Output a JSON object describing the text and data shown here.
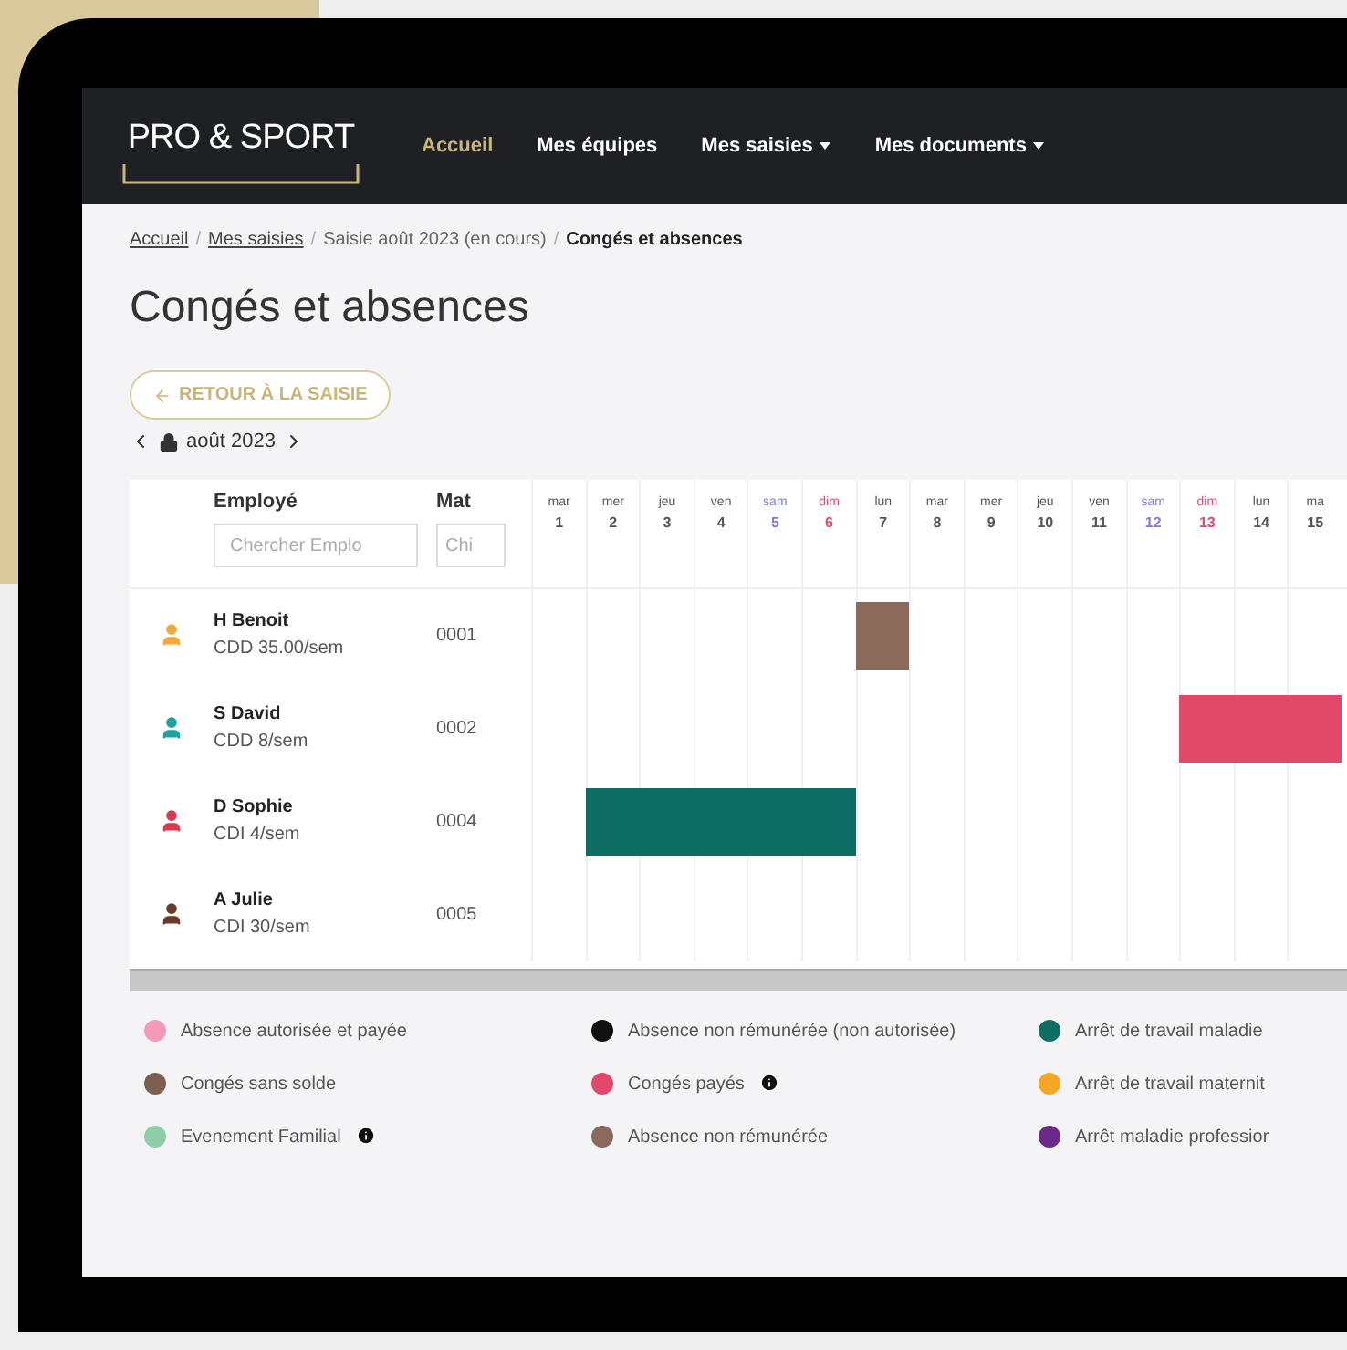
{
  "nav": {
    "logo": "PRO & SPORT",
    "links": [
      {
        "label": "Accueil",
        "selected": true,
        "dropdown": false
      },
      {
        "label": "Mes équipes",
        "selected": false,
        "dropdown": false
      },
      {
        "label": "Mes saisies",
        "selected": false,
        "dropdown": true
      },
      {
        "label": "Mes documents",
        "selected": false,
        "dropdown": true
      }
    ]
  },
  "breadcrumb": {
    "separator": "/",
    "items": [
      {
        "label": "Accueil",
        "kind": "link"
      },
      {
        "label": "Mes saisies",
        "kind": "link"
      },
      {
        "label": "Saisie août 2023 (en cours)",
        "kind": "plain"
      },
      {
        "label": "Congés et absences",
        "kind": "current"
      }
    ]
  },
  "title": "Congés et absences",
  "back_button": "RETOUR À LA SAISIE",
  "month": "août 2023",
  "table": {
    "columns": [
      "Employé",
      "Mat"
    ],
    "filters": [
      {
        "placeholder": "Chercher Emplo"
      },
      {
        "placeholder": "Chi"
      }
    ],
    "days": [
      {
        "weekday": "mar",
        "day": "1",
        "kind": "weekday"
      },
      {
        "weekday": "mer",
        "day": "2",
        "kind": "weekday"
      },
      {
        "weekday": "jeu",
        "day": "3",
        "kind": "weekday"
      },
      {
        "weekday": "ven",
        "day": "4",
        "kind": "weekday"
      },
      {
        "weekday": "sam",
        "day": "5",
        "kind": "saturday"
      },
      {
        "weekday": "dim",
        "day": "6",
        "kind": "sunday"
      },
      {
        "weekday": "lun",
        "day": "7",
        "kind": "weekday"
      },
      {
        "weekday": "mar",
        "day": "8",
        "kind": "weekday"
      },
      {
        "weekday": "mer",
        "day": "9",
        "kind": "weekday"
      },
      {
        "weekday": "jeu",
        "day": "10",
        "kind": "weekday"
      },
      {
        "weekday": "ven",
        "day": "11",
        "kind": "weekday"
      },
      {
        "weekday": "sam",
        "day": "12",
        "kind": "saturday"
      },
      {
        "weekday": "dim",
        "day": "13",
        "kind": "sunday"
      },
      {
        "weekday": "lun",
        "day": "14",
        "kind": "weekday"
      },
      {
        "weekday": "ma",
        "day": "15",
        "kind": "weekday"
      }
    ],
    "rows": [
      {
        "name": "H Benoit",
        "contract": "CDD 35.00/sem",
        "mat": "0001",
        "color": "#f2a93b",
        "cells": [
          {
            "absent": false
          },
          {
            "absent": false
          },
          {
            "absent": false
          },
          {
            "absent": false
          },
          {
            "absent": false
          },
          {
            "absent": false
          },
          {
            "absent": true,
            "color": "#8b6a5c"
          },
          {
            "absent": false
          },
          {
            "absent": false
          },
          {
            "absent": false
          },
          {
            "absent": false
          },
          {
            "absent": false
          },
          {
            "absent": false
          },
          {
            "absent": false
          },
          {
            "absent": false
          }
        ]
      },
      {
        "name": "S David",
        "contract": "CDD 8/sem",
        "mat": "0002",
        "color": "#1fa3a0",
        "cells": [
          {
            "absent": false
          },
          {
            "absent": false
          },
          {
            "absent": false
          },
          {
            "absent": false
          },
          {
            "absent": false
          },
          {
            "absent": false
          },
          {
            "absent": false
          },
          {
            "absent": false
          },
          {
            "absent": false
          },
          {
            "absent": false
          },
          {
            "absent": false
          },
          {
            "absent": false
          },
          {
            "absent": true,
            "color": "#e0496a"
          },
          {
            "absent": true,
            "color": "#e0496a"
          },
          {
            "absent": true,
            "color": "#e0496a"
          }
        ]
      },
      {
        "name": "D Sophie",
        "contract": "CDI 4/sem",
        "mat": "0004",
        "color": "#d93a4f",
        "cells": [
          {
            "absent": false
          },
          {
            "absent": true,
            "color": "#0e6e63"
          },
          {
            "absent": true,
            "color": "#0e6e63"
          },
          {
            "absent": true,
            "color": "#0e6e63"
          },
          {
            "absent": true,
            "color": "#0e6e63"
          },
          {
            "absent": true,
            "color": "#0e6e63"
          },
          {
            "absent": false
          },
          {
            "absent": false
          },
          {
            "absent": false
          },
          {
            "absent": false
          },
          {
            "absent": false
          },
          {
            "absent": false
          },
          {
            "absent": false
          },
          {
            "absent": false
          },
          {
            "absent": false
          }
        ]
      },
      {
        "name": "A Julie",
        "contract": "CDI 30/sem",
        "mat": "0005",
        "color": "#6b3b2a",
        "cells": [
          {
            "absent": false
          },
          {
            "absent": false
          },
          {
            "absent": false
          },
          {
            "absent": false
          },
          {
            "absent": false
          },
          {
            "absent": false
          },
          {
            "absent": false
          },
          {
            "absent": false
          },
          {
            "absent": false
          },
          {
            "absent": false
          },
          {
            "absent": false
          },
          {
            "absent": false
          },
          {
            "absent": false
          },
          {
            "absent": false
          },
          {
            "absent": false
          }
        ]
      }
    ]
  },
  "legend": [
    {
      "label": "Absence autorisée et payée",
      "color": "#f29ab8",
      "info": false
    },
    {
      "label": "Absence non rémunérée (non autorisée)",
      "color": "#111111",
      "info": false
    },
    {
      "label": "Arrêt de travail maladie",
      "color": "#0e6e63",
      "info": false
    },
    {
      "label": "Congés sans solde",
      "color": "#7d5f50",
      "info": false
    },
    {
      "label": "Congés payés",
      "color": "#e0496a",
      "info": true
    },
    {
      "label": "Arrêt de travail maternit",
      "color": "#f5a623",
      "info": false
    },
    {
      "label": "Evenement Familial",
      "color": "#8fcfa8",
      "info": true
    },
    {
      "label": "Absence non rémunérée",
      "color": "#8b6a5c",
      "info": false
    },
    {
      "label": "Arrêt maladie professior",
      "color": "#6a2a8a",
      "info": false
    }
  ]
}
